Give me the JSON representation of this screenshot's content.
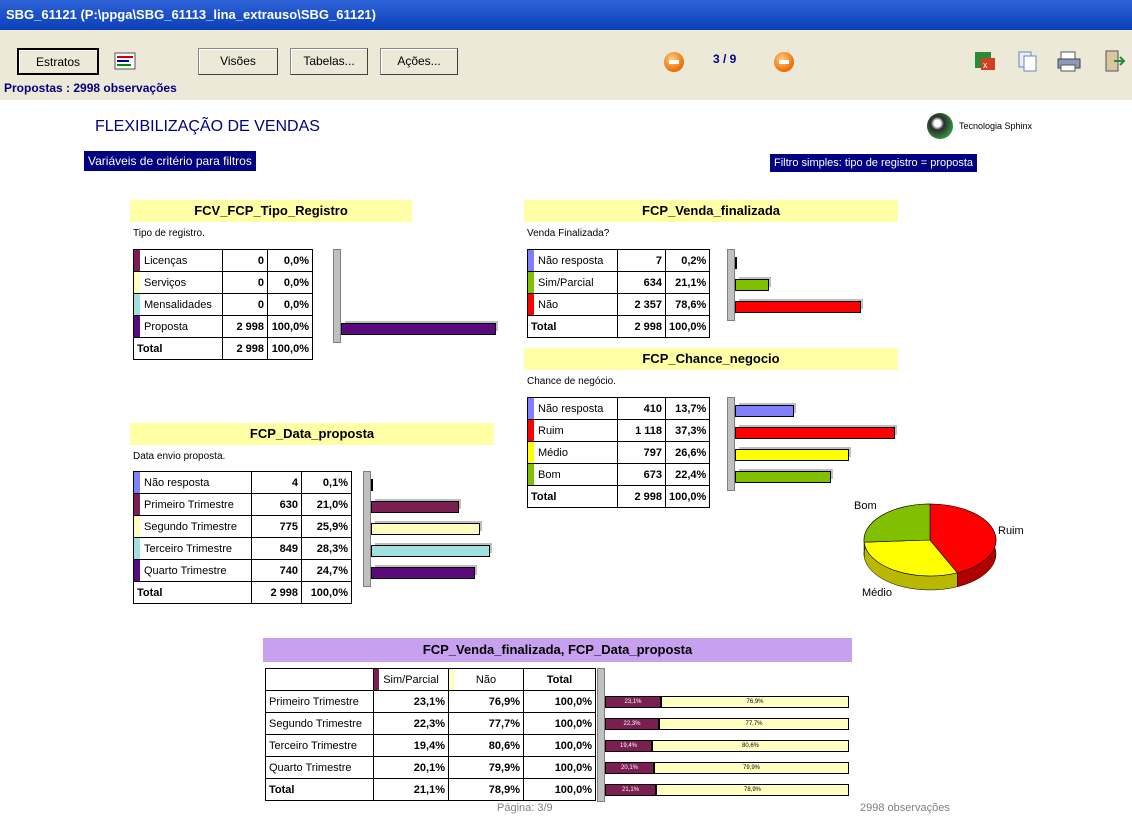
{
  "window": {
    "title": "SBG_61121 (P:\\ppga\\SBG_61113_lina_extrauso\\SBG_61121)"
  },
  "toolbar": {
    "estratos": "Estratos",
    "visoes": "Visões",
    "tabelas": "Tabelas...",
    "acoes": "Ações...",
    "observations": "Propostas : 2998 observações",
    "page_indicator": "3 / 9"
  },
  "report": {
    "title": "FLEXIBILIZAÇÃO DE VENDAS",
    "logo_text": "Tecnologia Sphinx",
    "filter_vars": "Variáveis de critério para filtros",
    "filter_simple": "Filtro simples: tipo de registro = proposta",
    "footer_page": "Página: 3/9",
    "footer_obs": "2998 observações"
  },
  "colors": {
    "title_bar": "#0a3fb8",
    "navy": "#000080",
    "yellow_header": "#ffffa6",
    "purple_header": "#c8a0f0"
  },
  "tables": {
    "tipo_registro": {
      "title": "FCV_FCP_Tipo_Registro",
      "caption": "Tipo de registro.",
      "rows": [
        {
          "label": "Licenças",
          "n": "0",
          "pct": "0,0%",
          "value": 0,
          "color": "#7b1e52"
        },
        {
          "label": "Serviços",
          "n": "0",
          "pct": "0,0%",
          "value": 0,
          "color": "#ffffc0"
        },
        {
          "label": "Mensalidades",
          "n": "0",
          "pct": "0,0%",
          "value": 0,
          "color": "#a0e0e0"
        },
        {
          "label": "Proposta",
          "n": "2 998",
          "pct": "100,0%",
          "value": 100,
          "color": "#5a0a7a"
        }
      ],
      "total": {
        "label": "Total",
        "n": "2 998",
        "pct": "100,0%"
      }
    },
    "venda_finalizada": {
      "title": "FCP_Venda_finalizada",
      "caption": "Venda Finalizada?",
      "rows": [
        {
          "label": "Não resposta",
          "n": "7",
          "pct": "0,2%",
          "value": 0.2,
          "color": "#8080ff"
        },
        {
          "label": "Sim/Parcial",
          "n": "634",
          "pct": "21,1%",
          "value": 21.1,
          "color": "#80c000"
        },
        {
          "label": "Não",
          "n": "2 357",
          "pct": "78,6%",
          "value": 78.6,
          "color": "#ff0000"
        }
      ],
      "total": {
        "label": "Total",
        "n": "2 998",
        "pct": "100,0%"
      }
    },
    "chance_negocio": {
      "title": "FCP_Chance_negocio",
      "caption": "Chance de negócio.",
      "rows": [
        {
          "label": "Não resposta",
          "n": "410",
          "pct": "13,7%",
          "value": 13.7,
          "color": "#8080ff"
        },
        {
          "label": "Ruim",
          "n": "1 118",
          "pct": "37,3%",
          "value": 37.3,
          "color": "#ff0000"
        },
        {
          "label": "Médio",
          "n": "797",
          "pct": "26,6%",
          "value": 26.6,
          "color": "#ffff00"
        },
        {
          "label": "Bom",
          "n": "673",
          "pct": "22,4%",
          "value": 22.4,
          "color": "#80c000"
        }
      ],
      "total": {
        "label": "Total",
        "n": "2 998",
        "pct": "100,0%"
      },
      "pie_labels": {
        "bom": "Bom",
        "ruim": "Ruim",
        "medio": "Médio"
      }
    },
    "data_proposta": {
      "title": "FCP_Data_proposta",
      "caption": "Data envio proposta.",
      "rows": [
        {
          "label": "Não resposta",
          "n": "4",
          "pct": "0,1%",
          "value": 0.1,
          "color": "#8080ff"
        },
        {
          "label": "Primeiro Trimestre",
          "n": "630",
          "pct": "21,0%",
          "value": 21.0,
          "color": "#7b1e52"
        },
        {
          "label": "Segundo Trimestre",
          "n": "775",
          "pct": "25,9%",
          "value": 25.9,
          "color": "#ffffc0"
        },
        {
          "label": "Terceiro Trimestre",
          "n": "849",
          "pct": "28,3%",
          "value": 28.3,
          "color": "#a0e0e0"
        },
        {
          "label": "Quarto Trimestre",
          "n": "740",
          "pct": "24,7%",
          "value": 24.7,
          "color": "#5a0a7a"
        }
      ],
      "total": {
        "label": "Total",
        "n": "2 998",
        "pct": "100,0%"
      }
    },
    "cross": {
      "title": "FCP_Venda_finalizada, FCP_Data_proposta",
      "headers": [
        "Sim/Parcial",
        "Não",
        "Total"
      ],
      "rows": [
        {
          "label": "Primeiro Trimestre",
          "sim": "23,1%",
          "nao": "76,9%",
          "total": "100,0%",
          "sim_v": 23.1
        },
        {
          "label": "Segundo Trimestre",
          "sim": "22,3%",
          "nao": "77,7%",
          "total": "100,0%",
          "sim_v": 22.3
        },
        {
          "label": "Terceiro Trimestre",
          "sim": "19,4%",
          "nao": "80,6%",
          "total": "100,0%",
          "sim_v": 19.4
        },
        {
          "label": "Quarto Trimestre",
          "sim": "20,1%",
          "nao": "79,9%",
          "total": "100,0%",
          "sim_v": 20.1
        },
        {
          "label": "Total",
          "sim": "21,1%",
          "nao": "78,9%",
          "total": "100,0%",
          "sim_v": 21.1
        }
      ]
    }
  }
}
